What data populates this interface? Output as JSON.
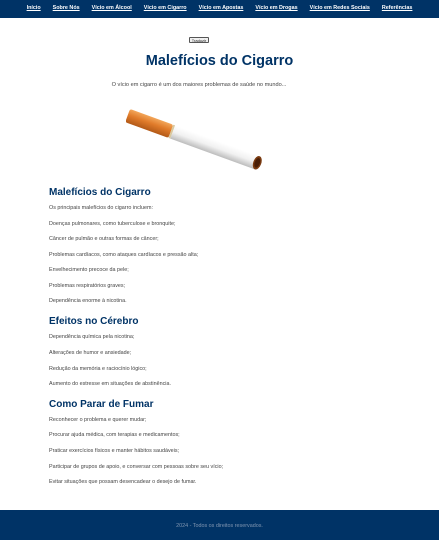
{
  "nav": {
    "items": [
      {
        "label": "Início"
      },
      {
        "label": "Sobre Nós"
      },
      {
        "label": "Vício em Álcool"
      },
      {
        "label": "Vício em Cigarro"
      },
      {
        "label": "Vício em Apostas"
      },
      {
        "label": "Vício em Drogas"
      },
      {
        "label": "Vício em Redes Sociais"
      },
      {
        "label": "Referências"
      }
    ]
  },
  "translate_button": "Traduzir",
  "page_title": "Malefícios do Cigarro",
  "intro": "O vício em cigarro é um dos maiores problemas de saúde no mundo...",
  "image": {
    "subject": "cigarette-image"
  },
  "sections": [
    {
      "title": "Malefícios do Cigarro",
      "items": [
        "Os principais malefícios do cigarro incluem:",
        "Doenças pulmonares, como tuberculose e bronquite;",
        "Câncer de pulmão e outras formas de câncer;",
        "Problemas cardíacos, como ataques cardíacos e pressão alta;",
        "Envelhecimento precoce da pele;",
        "Problemas respiratórios graves;",
        "Dependência enorme à nicotina."
      ]
    },
    {
      "title": "Efeitos no Cérebro",
      "items": [
        "Dependência química pela nicotina;",
        "Alterações de humor e ansiedade;",
        "Redução da memória e raciocínio lógico;",
        "Aumento do estresse em situações de abstinência."
      ]
    },
    {
      "title": "Como Parar de Fumar",
      "items": [
        "Reconhecer o problema e querer mudar;",
        "Procurar ajuda médica, com terapias e medicamentos;",
        "Praticar exercícios físicos e manter hábitos saudáveis;",
        "Participar de grupos de apoio, e conversar com pessoas sobre seu vício;",
        "Evitar situações que possam desencadear o desejo de fumar."
      ]
    }
  ],
  "footer": "2024 - Todos os direitos reservados.",
  "colors": {
    "primary": "#003366",
    "background": "#ffffff",
    "text": "#444444"
  }
}
